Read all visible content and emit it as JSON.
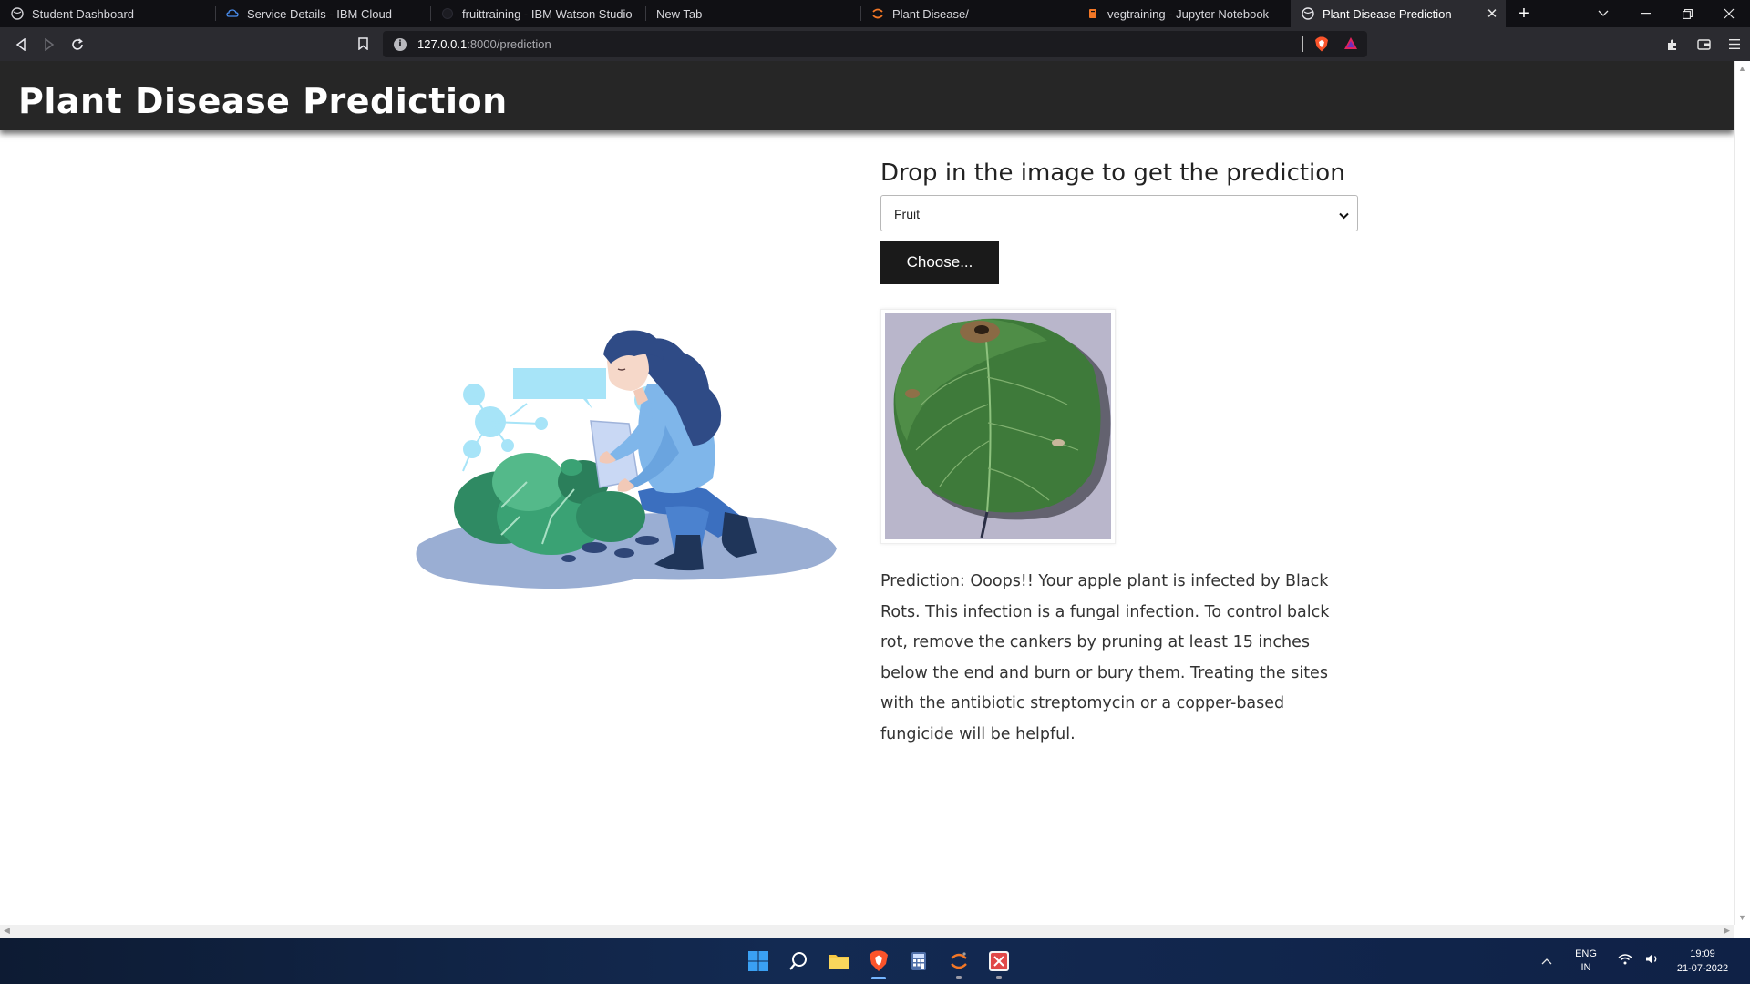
{
  "browser": {
    "tabs": [
      {
        "label": "Student Dashboard",
        "active": false
      },
      {
        "label": "Service Details - IBM Cloud",
        "active": false
      },
      {
        "label": "fruittraining - IBM Watson Studio",
        "active": false
      },
      {
        "label": "New Tab",
        "active": false
      },
      {
        "label": "Plant Disease/",
        "active": false
      },
      {
        "label": "vegtraining - Jupyter Notebook",
        "active": false
      },
      {
        "label": "Plant Disease Prediction",
        "active": true
      }
    ],
    "new_tab_glyph": "+",
    "url_host": "127.0.0.1",
    "url_rest": ":8000/prediction"
  },
  "page": {
    "title": "Plant Disease Prediction",
    "drop_heading": "Drop in the image to get the prediction",
    "category_select": {
      "value": "Fruit"
    },
    "choose_button": "Choose...",
    "prediction_text": "Prediction: Ooops!! Your apple plant is infected by Black Rots. This infection is a fungal infection. To control balck rot, remove the cankers by pruning at least 15 inches below the end and burn or bury them. Treating the sites with the antibiotic streptomycin or a copper-based fungicide will be helpful."
  },
  "taskbar": {
    "icons": [
      "windows-start-icon",
      "search-icon",
      "file-explorer-icon",
      "brave-browser-icon",
      "calculator-icon",
      "jupyter-icon",
      "snipping-tool-icon"
    ],
    "lang_line1": "ENG",
    "lang_line2": "IN",
    "time": "19:09",
    "date": "21-07-2022"
  },
  "colors": {
    "header_bg": "#262626",
    "button_bg": "#1a1a1a",
    "tab_bar_bg": "#101014",
    "toolbar_bg": "#2b2b30"
  }
}
